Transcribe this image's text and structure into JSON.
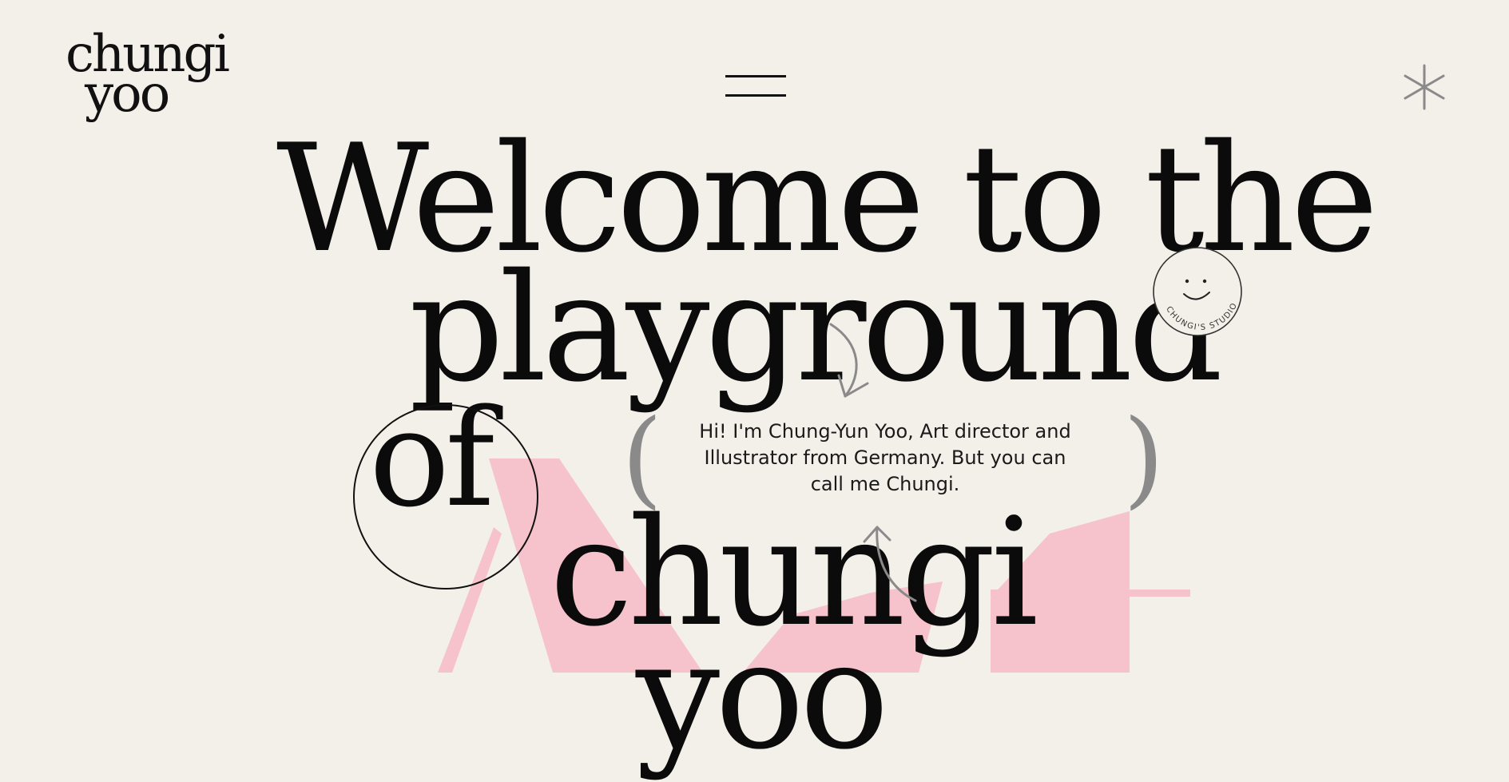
{
  "header": {
    "logo_line1": "chungi",
    "logo_line2": "yoo"
  },
  "icons": {
    "menu": "hamburger-icon",
    "asterisk": "asterisk-icon",
    "stamp": "smiley-stamp-icon"
  },
  "hero": {
    "line1": "Welcome to the",
    "line2": "playground",
    "line3": "of",
    "line4": "chungi",
    "line5": "yoo",
    "background_word": "Art"
  },
  "badge": {
    "text": "CHUNGI'S STUDIO"
  },
  "intro": {
    "paren_left": "(",
    "paren_right": ")",
    "text": "Hi! I'm Chung-Yun Yoo, Art director and Illustrator from Germany. But you can call me Chungi."
  },
  "colors": {
    "background": "#f3efe9",
    "text": "#0b0b0b",
    "accent_pink": "#f6c2cc",
    "muted_gray": "#8a8a8a"
  }
}
